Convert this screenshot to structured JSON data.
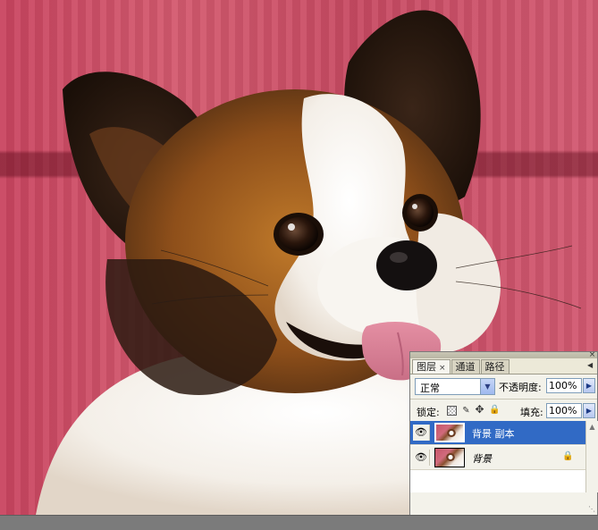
{
  "layers_panel": {
    "tabs": [
      {
        "label": "图层",
        "closable": true,
        "active": true
      },
      {
        "label": "通道",
        "closable": false,
        "active": false
      },
      {
        "label": "路径",
        "closable": false,
        "active": false
      }
    ],
    "close_symbol": "×",
    "panel_close_symbol": "×",
    "blend_mode": "正常",
    "opacity_label": "不透明度:",
    "opacity_value": "100%",
    "lock_label": "锁定:",
    "fill_label": "填充:",
    "fill_value": "100%",
    "lock_icons": [
      "lock-transparent-icon",
      "lock-brush-icon",
      "lock-move-icon",
      "lock-all-icon"
    ],
    "layers": [
      {
        "name": "背景 副本",
        "selected": true,
        "visible": true,
        "locked": false
      },
      {
        "name": "背景",
        "selected": false,
        "visible": true,
        "locked": true
      }
    ]
  },
  "colors": {
    "selection": "#316ac5",
    "panel_bg": "#ece9d8",
    "canvas_background": "#c94560"
  }
}
